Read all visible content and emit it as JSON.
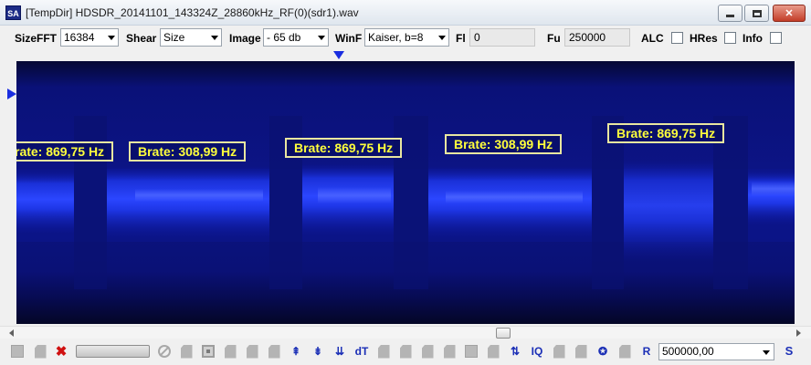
{
  "window": {
    "icon_text": "SA",
    "title": "[TempDir] HDSDR_20141101_143324Z_28860kHz_RF(0)(sdr1).wav",
    "min_glyph": "minimize-icon",
    "max_glyph": "maximize-icon",
    "close_glyph": "✕"
  },
  "toolbar": {
    "sizefft_label": "SizeFFT",
    "sizefft_value": "16384",
    "shear_label": "Shear",
    "shear_value": "Size",
    "image_label": "Image",
    "image_value": "- 65 db",
    "winf_label": "WinF",
    "winf_value": "Kaiser, b=8",
    "fl_label": "Fl",
    "fl_value": "0",
    "fu_label": "Fu",
    "fu_value": "250000",
    "alc_label": "ALC",
    "hres_label": "HRes",
    "info_label": "Info"
  },
  "labels": [
    {
      "text": "rate: 869,75 Hz"
    },
    {
      "text": "Brate: 308,99 Hz"
    },
    {
      "text": "Brate: 869,75 Hz"
    },
    {
      "text": "Brate: 308,99 Hz"
    },
    {
      "text": "Brate: 869,75 Hz"
    }
  ],
  "bottom": {
    "dt_label": "dT",
    "iq_label": "IQ",
    "r_label": "R",
    "value": "500000,00",
    "s_label": "S"
  },
  "colors": {
    "spectrum_bg": "#060a5c",
    "signal": "#2b46ff",
    "label_text": "#ffff3c",
    "label_border": "#e8e6a0"
  }
}
